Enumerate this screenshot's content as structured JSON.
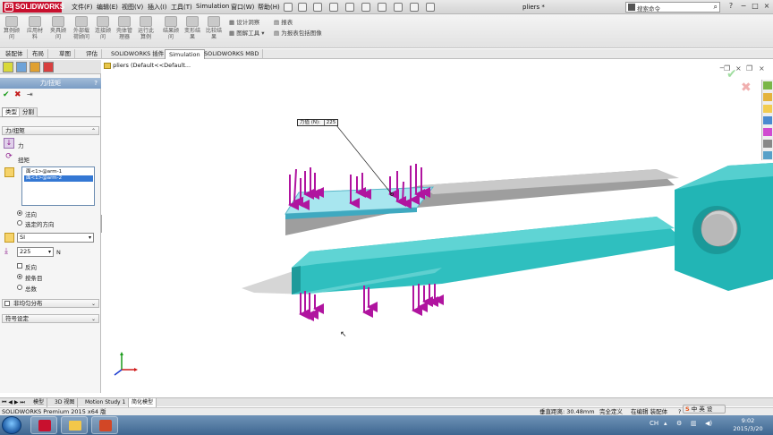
{
  "titlebar": {
    "logo_text": "SOLIDWORKS",
    "logo_mark": "DS",
    "menus": [
      "文件(F)",
      "编辑(E)",
      "视图(V)",
      "插入(I)",
      "工具(T)",
      "Simulation",
      "窗口(W)",
      "帮助(H)"
    ],
    "document_title": "pliers *",
    "search_placeholder": "搜索命令",
    "min_glyph": "−",
    "max_glyph": "□",
    "close_glyph": "×"
  },
  "ribbon": {
    "buttons": [
      "算例顾问",
      "应用材料",
      "夹具顾问",
      "外部载荷顾问",
      "连接顾问",
      "壳体管理器",
      "运行此算例",
      "结果顾问",
      "变形结果",
      "比较结果"
    ],
    "small_items": [
      "设计洞察",
      "图解工具",
      "报表",
      "为报表包括图像"
    ]
  },
  "tabs": [
    "装配体",
    "布局",
    "草图",
    "评估",
    "SOLIDWORKS 插件",
    "Simulation",
    "SOLIDWORKS MBD"
  ],
  "active_tab": "Simulation",
  "panel": {
    "title": "力/扭矩",
    "help": "?",
    "ok_glyph": "✔",
    "cancel_glyph": "✖",
    "pin_glyph": "⇥",
    "subtabs": [
      "类型",
      "分割"
    ],
    "section_force": "力/扭矩",
    "type_force": "力",
    "type_torque": "扭矩",
    "faces": [
      "面<1>@arm-1",
      "面<1>@arm-2"
    ],
    "dir_normal": "法向",
    "dir_selected": "选定的方向",
    "unit": "SI",
    "value": "225",
    "value_unit": "N",
    "reverse": "反向",
    "per_item": "按条目",
    "total": "总数",
    "section_nonuniform": "非均匀分布",
    "section_symbol": "符号设定"
  },
  "viewport": {
    "tree_label": "pliers  (Default<<Default...",
    "callout_label": "力值 (N):",
    "callout_value": "225"
  },
  "bottom_tabs": [
    "模型",
    "3D 视图",
    "Motion Study 1",
    "简化模型"
  ],
  "status": {
    "left": "SOLIDWORKS Premium 2015 x64 版",
    "distance": "垂直距离: 30.48mm",
    "state": "完全定义",
    "mode": "在编辑 装配体"
  },
  "taskbar": {
    "time": "9:02",
    "date": "2015/3/20",
    "ime_items": [
      "中",
      "英",
      "设"
    ],
    "tray_text": "CH"
  },
  "colors": {
    "accent_teal": "#2fbfbf",
    "light_blue": "#a8e6ef",
    "gray_arm": "#a8a8a8",
    "arrow_magenta": "#b0149f"
  }
}
